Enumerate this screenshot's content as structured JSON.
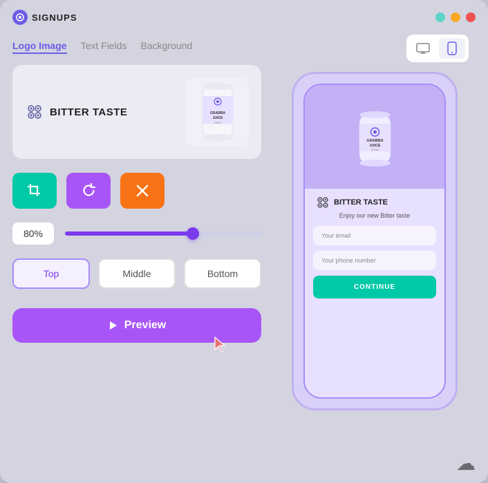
{
  "titlebar": {
    "app_name": "SIGNUPS",
    "dots": [
      {
        "color": "#5ed4c8",
        "name": "dot-green"
      },
      {
        "color": "#f9a825",
        "name": "dot-yellow"
      },
      {
        "color": "#ef5350",
        "name": "dot-red"
      }
    ]
  },
  "tabs": [
    {
      "label": "Logo Image",
      "active": true
    },
    {
      "label": "Text Fields",
      "active": false
    },
    {
      "label": "Background",
      "active": false
    }
  ],
  "preview_card": {
    "brand_name": "BITTER TASTE"
  },
  "tools": {
    "crop_label": "✂",
    "rotate_label": "↺",
    "remove_label": "✕"
  },
  "slider": {
    "percent": "80%",
    "fill_width": "65%"
  },
  "position_buttons": [
    {
      "label": "Top",
      "active": true
    },
    {
      "label": "Middle",
      "active": false
    },
    {
      "label": "Bottom",
      "active": false
    }
  ],
  "preview_button": {
    "label": "Preview"
  },
  "view_toggle": [
    {
      "icon": "🖥",
      "active": false
    },
    {
      "icon": "📱",
      "active": true
    }
  ],
  "phone_preview": {
    "brand_name": "BITTER TASTE",
    "tagline": "Enjoy our new Bitter taste",
    "email_placeholder": "Your email",
    "phone_placeholder": "Your phone number",
    "cta_label": "CONTINUE"
  }
}
